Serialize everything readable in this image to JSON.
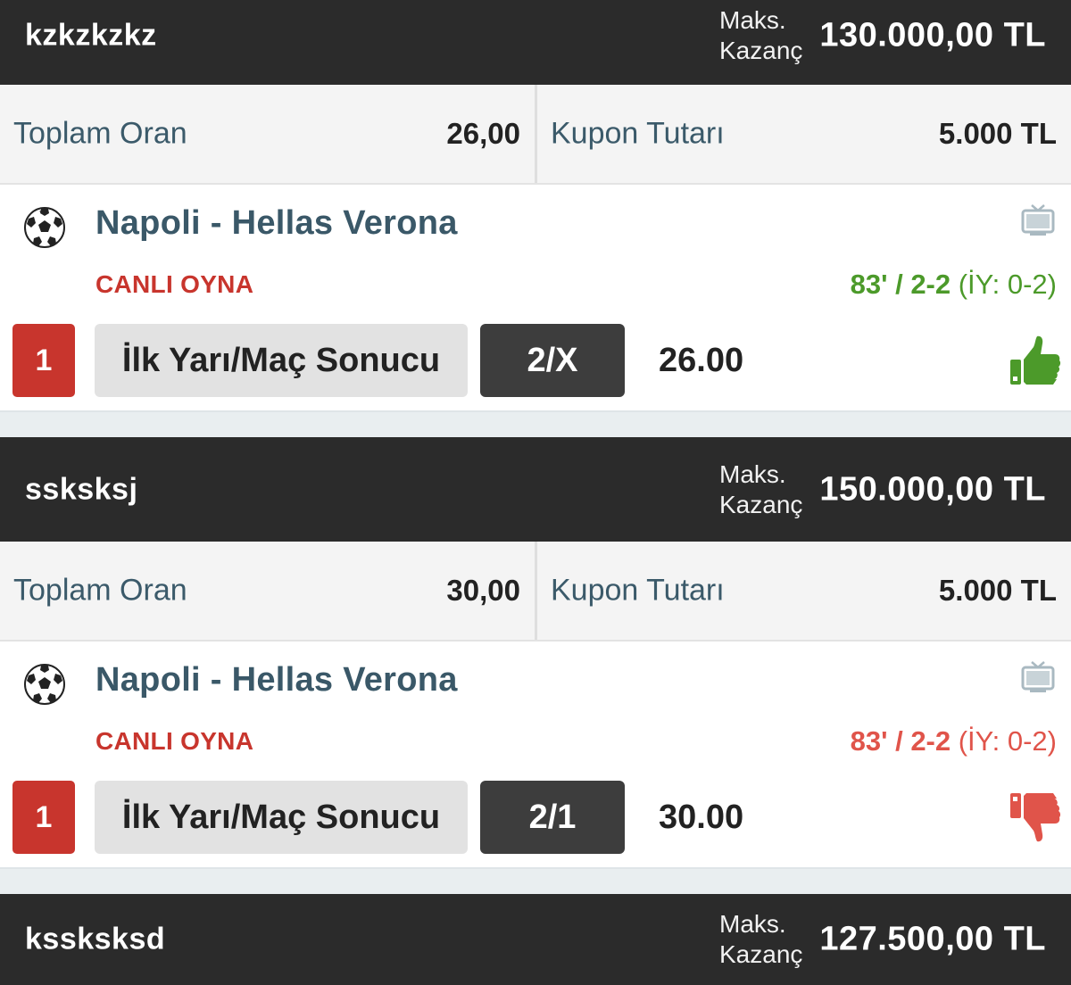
{
  "colors": {
    "header_bg": "#2b2b2b",
    "live_red": "#c8352d",
    "win_green": "#4c9a2a",
    "lose_red": "#e0544a",
    "team_text": "#3a5868"
  },
  "coupons": [
    {
      "name": "kzkzkzkz",
      "max_win_label_line1": "Maks.",
      "max_win_label_line2": "Kazanç",
      "max_win_amount": "130.000,00 TL",
      "total_odds_label": "Toplam Oran",
      "total_odds": "26,00",
      "stake_label": "Kupon Tutarı",
      "stake": "5.000 TL",
      "event": {
        "sport_icon": "soccer-ball-icon",
        "match": "Napoli - Hellas Verona",
        "live_label": "CANLI OYNA",
        "minute_score": "83' / 2-2",
        "half_time": " (İY: 0-2)",
        "number": "1",
        "market": "İlk Yarı/Maç Sonucu",
        "pick": "2/X",
        "odd": "26.00",
        "result": "won",
        "result_icon": "thumbs-up-icon"
      }
    },
    {
      "name": "ssksksj",
      "max_win_label_line1": "Maks.",
      "max_win_label_line2": "Kazanç",
      "max_win_amount": "150.000,00 TL",
      "total_odds_label": "Toplam Oran",
      "total_odds": "30,00",
      "stake_label": "Kupon Tutarı",
      "stake": "5.000 TL",
      "event": {
        "sport_icon": "soccer-ball-icon",
        "match": "Napoli - Hellas Verona",
        "live_label": "CANLI OYNA",
        "minute_score": "83' / 2-2",
        "half_time": " (İY: 0-2)",
        "number": "1",
        "market": "İlk Yarı/Maç Sonucu",
        "pick": "2/1",
        "odd": "30.00",
        "result": "lost",
        "result_icon": "thumbs-down-icon"
      }
    },
    {
      "name": "kssksksd",
      "max_win_label_line1": "Maks.",
      "max_win_label_line2": "Kazanç",
      "max_win_amount": "127.500,00 TL"
    }
  ]
}
